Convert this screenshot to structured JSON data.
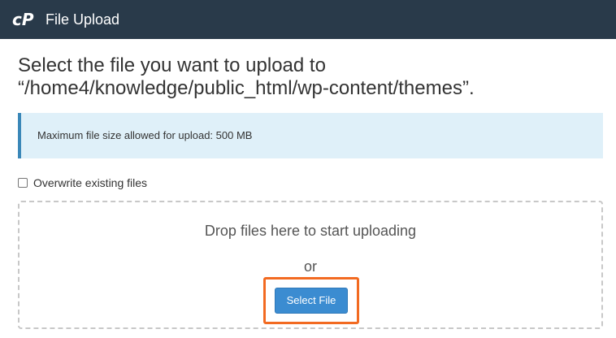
{
  "header": {
    "title": "File Upload",
    "logo_icon": "cpanel-logo-icon",
    "background": "#293a4a"
  },
  "main": {
    "heading_line1": "Select the file you want to upload to",
    "heading_line2": "“/home4/knowledge/public_html/wp-content/themes”.",
    "info": "Maximum file size allowed for upload: 500 MB",
    "overwrite_label": "Overwrite existing files",
    "overwrite_checked": false,
    "dropzone": {
      "text": "Drop files here to start uploading",
      "or": "or",
      "select_button": "Select File"
    }
  },
  "colors": {
    "accent": "#3b8cd1",
    "info_bg": "#dff0f9",
    "highlight": "#f26a21"
  }
}
